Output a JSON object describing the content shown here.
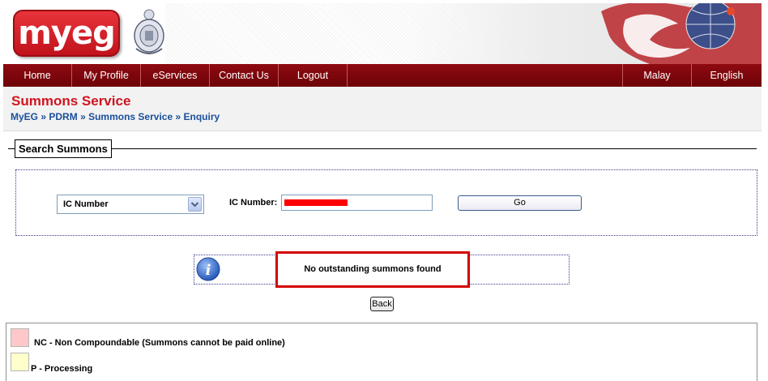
{
  "header": {
    "logo_text": "myeg"
  },
  "nav": {
    "items": [
      {
        "label": "Home"
      },
      {
        "label": "My Profile"
      },
      {
        "label": "eServices"
      },
      {
        "label": "Contact Us"
      },
      {
        "label": "Logout"
      }
    ],
    "languages": [
      {
        "label": "Malay"
      },
      {
        "label": "English"
      }
    ]
  },
  "page": {
    "title": "Summons Service",
    "breadcrumb": {
      "items": [
        "MyEG",
        "PDRM",
        "Summons Service",
        "Enquiry"
      ],
      "separator": "»"
    }
  },
  "search": {
    "legend": "Search Summons",
    "type_select_value": "IC Number",
    "ic_label": "IC Number:",
    "ic_value": "",
    "go_label": "Go"
  },
  "result": {
    "message": "No outstanding summons found"
  },
  "back_label": "Back",
  "legend": {
    "items": [
      {
        "color": "#ffc8c8",
        "text": "NC - Non Compoundable (Summons cannot be paid online)"
      },
      {
        "color": "#ffffcc",
        "text": "P - Processing"
      }
    ]
  },
  "colors": {
    "nav_bg": "#7d060c",
    "title_red": "#d1141f",
    "breadcrumb_blue": "#1a4f9c",
    "highlight_red": "#d40000"
  }
}
